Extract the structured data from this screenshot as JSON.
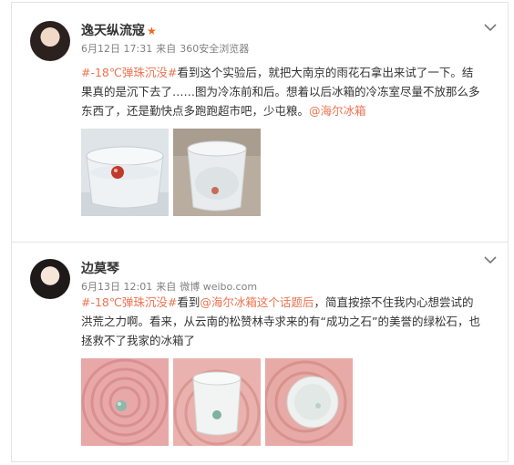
{
  "posts": [
    {
      "user": "逸天纵流寇",
      "verified_icon": "star-icon",
      "date": "6月12日 17:31",
      "source_prefix": "来自",
      "source": "360安全浏览器",
      "tag": "#-18℃弹珠沉没#",
      "text_main": "看到这个实验后，就把大南京的雨花石拿出来试了一下。结果真的是沉下去了……图为冷冻前和后。想着以后冰箱的冷冻室尽量不放那么多东西了，还是勤快点多跑跑超市吧，少屯粮。",
      "mention": "@海尔冰箱",
      "photo_count": 2
    },
    {
      "user": "边莫琴",
      "date": "6月13日 12:01",
      "source_prefix": "来自",
      "source": "微博 weibo.com",
      "tag": "#-18℃弹珠沉没#",
      "text_mid": "看到",
      "mention": "@海尔冰箱这个话题后",
      "text_main": "，简直按捺不住我内心想尝试的洪荒之力啊。看来，从云南的松赞林寺求来的有“成功之石”的美誉的绿松石，也拯救不了我家的冰箱了",
      "photo_count": 3
    }
  ],
  "colors": {
    "link": "#eb7350",
    "meta": "#808080",
    "text": "#333333",
    "star": "#f26522"
  }
}
